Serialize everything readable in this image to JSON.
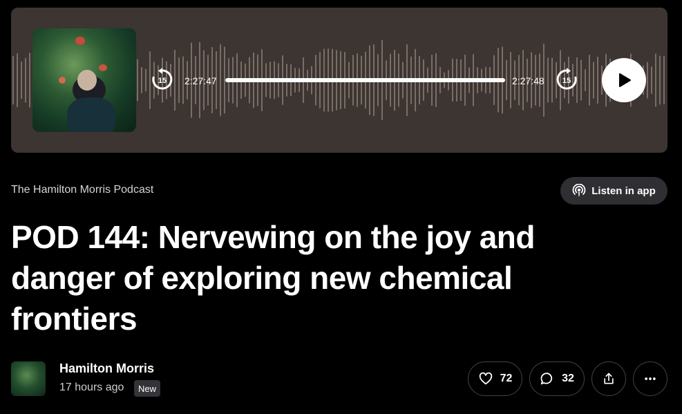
{
  "player": {
    "cover_alt": "podcast-cover",
    "rewind_label": "15",
    "forward_label": "15",
    "current_time": "2:27:47",
    "duration": "2:27:48",
    "progress": 0.999,
    "icons": {
      "rewind": "rewind-15-icon",
      "forward": "forward-15-icon",
      "play": "play-icon"
    }
  },
  "podcast": {
    "name": "The Hamilton Morris Podcast"
  },
  "listen_in_app": {
    "label": "Listen in app",
    "icon": "podcast-icon"
  },
  "episode": {
    "title": "POD 144: Nervewing on the joy and danger of exploring new chemical frontiers"
  },
  "author": {
    "name": "Hamilton Morris",
    "posted": "17 hours ago",
    "badge": "New"
  },
  "actions": {
    "likes": "72",
    "comments": "32",
    "icons": {
      "like": "heart-icon",
      "comment": "comment-icon",
      "share": "share-icon",
      "more": "more-icon"
    }
  },
  "colors": {
    "player_bg": "#3c3532",
    "wave": "#7a6e66",
    "page_bg": "#000000",
    "chip_bg": "#2e2e33"
  }
}
